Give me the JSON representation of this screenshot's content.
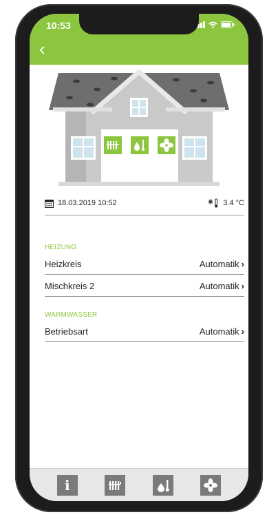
{
  "status": {
    "time": "10:53"
  },
  "header": {
    "back_glyph": "‹"
  },
  "info": {
    "datetime": "18.03.2019 10:52",
    "temperature": "3.4 °C",
    "calendar_icon": "calendar-icon",
    "thermo_icon": "outdoor-temperature-icon"
  },
  "sections": {
    "heating": {
      "title": "HEIZUNG",
      "rows": [
        {
          "label": "Heizkreis",
          "value": "Automatik"
        },
        {
          "label": "Mischkreis 2",
          "value": "Automatik"
        }
      ]
    },
    "hotwater": {
      "title": "WARMWASSER",
      "rows": [
        {
          "label": "Betriebsart",
          "value": "Automatik"
        }
      ]
    }
  },
  "bottom_nav": {
    "info_glyph": "i",
    "items": [
      "info-icon",
      "radiator-icon",
      "water-temperature-icon",
      "fan-icon"
    ]
  },
  "colors": {
    "accent": "#8cc63f",
    "icon_grey": "#7a7a7a",
    "text": "#222222"
  }
}
